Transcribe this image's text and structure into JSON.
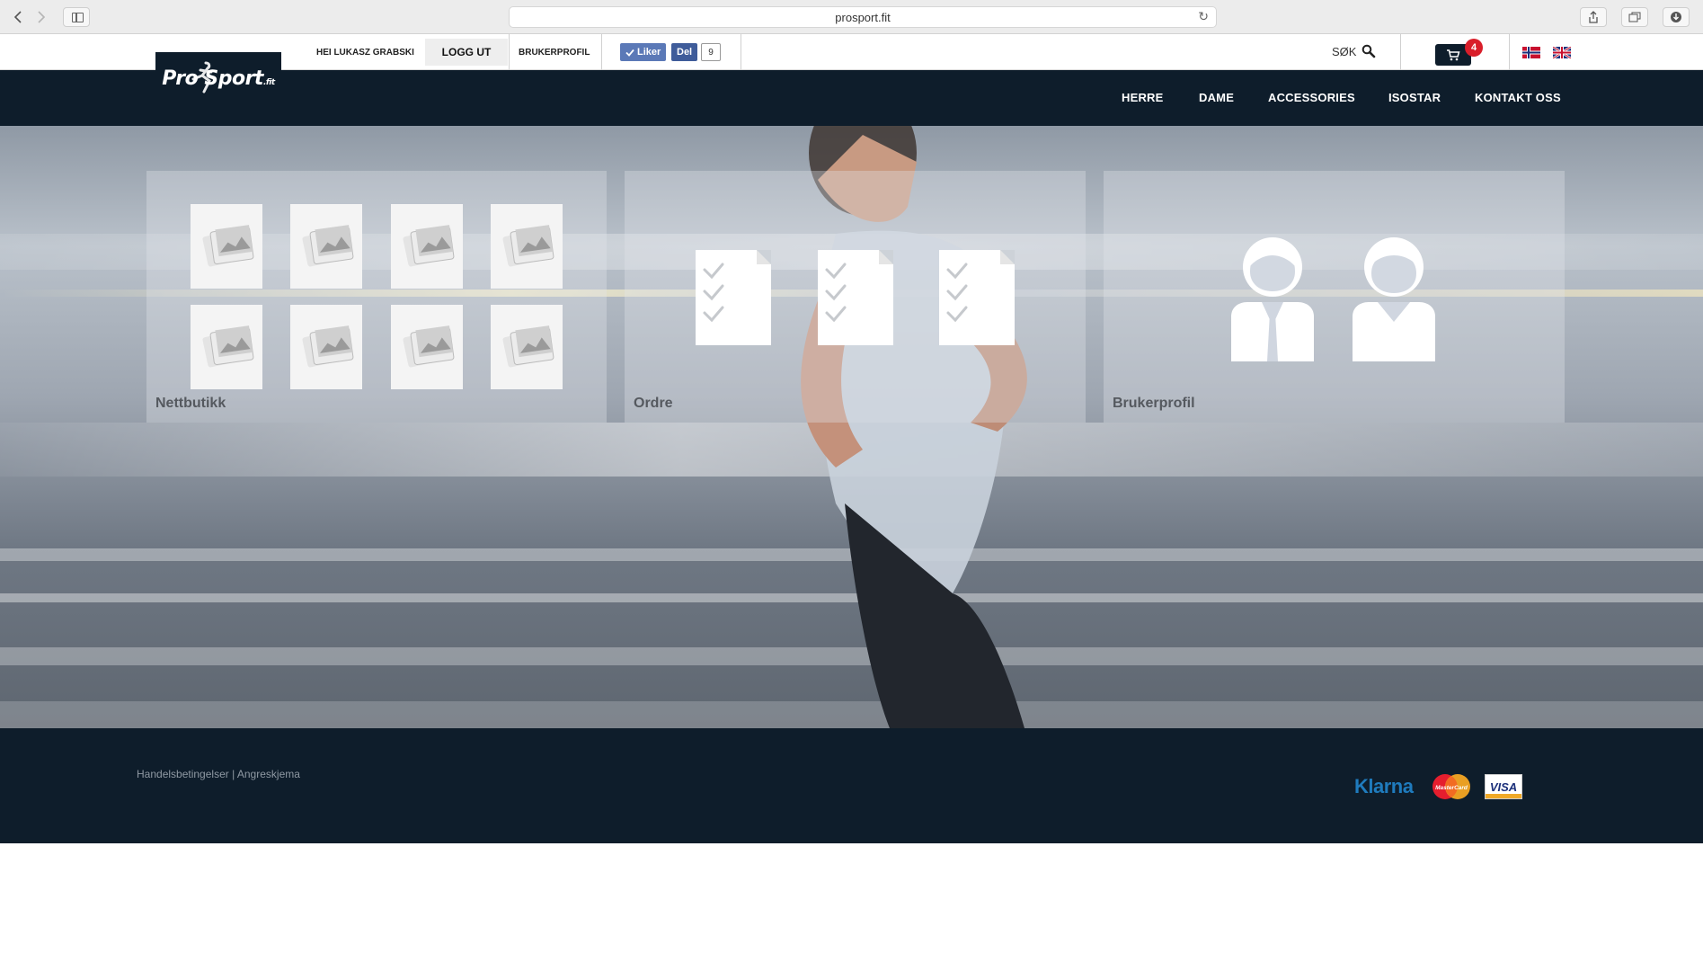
{
  "browser": {
    "url": "prosport.fit",
    "back_icon": "chevron-left-icon",
    "forward_icon": "chevron-right-icon",
    "reload_icon": "reload-icon"
  },
  "topbar": {
    "greeting": "HEI LUKASZ GRABSKI",
    "logout_label": "LOGG UT",
    "profile_label": "BRUKERPROFIL",
    "fb_like_label": "Liker",
    "fb_share_label": "Del",
    "fb_count": "9",
    "search_label": "SØK",
    "cart_count": "4"
  },
  "logo": {
    "text": "Pro Sport",
    "suffix": ".fit"
  },
  "nav": {
    "items": [
      "HERRE",
      "DAME",
      "ACCESSORIES",
      "ISOSTAR",
      "KONTAKT OSS"
    ]
  },
  "panels": {
    "shop_label": "Nettbutikk",
    "orders_label": "Ordre",
    "profile_label": "Brukerprofil"
  },
  "footer": {
    "terms": "Handelsbetingelser",
    "separator": "|",
    "withdrawal": "Angreskjema",
    "klarna": "Klarna",
    "mastercard": "MasterCard",
    "visa": "VISA"
  },
  "colors": {
    "navy": "#0e1d2b",
    "cart_badge": "#d91e2a",
    "facebook": "#5b79b7",
    "klarna": "#1f7bbd"
  }
}
